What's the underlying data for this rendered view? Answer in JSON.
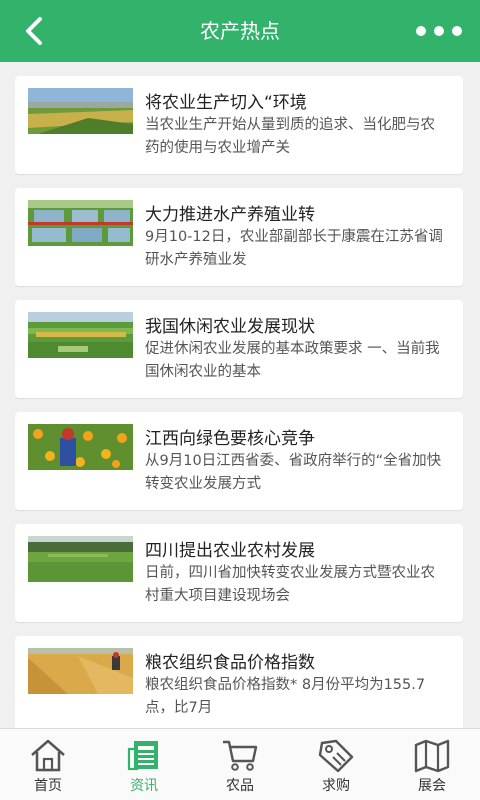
{
  "header": {
    "title": "农产热点"
  },
  "colors": {
    "accent": "#33b26b",
    "background": "#f0f0f0"
  },
  "articles": [
    {
      "title": "将农业生产切入“环境",
      "desc": "当农业生产开始从量到质的追求、当化肥与农药的使用与农业增产关"
    },
    {
      "title": "大力推进水产养殖业转",
      "desc": "9月10-12日，农业部副部长于康震在江苏省调研水产养殖业发"
    },
    {
      "title": "我国休闲农业发展现状",
      "desc": "促进休闲农业发展的基本政策要求 一、当前我国休闲农业的基本"
    },
    {
      "title": "江西向绿色要核心竞争",
      "desc": "从9月10日江西省委、省政府举行的“全省加快转变农业发展方式"
    },
    {
      "title": "四川提出农业农村发展",
      "desc": "日前，四川省加快转变农业发展方式暨农业农村重大项目建设现场会"
    },
    {
      "title": "粮农组织食品价格指数",
      "desc": "粮农组织食品价格指数* 8月份平均为155.7点，比7月"
    }
  ],
  "tabbar": {
    "items": [
      {
        "label": "首页",
        "icon": "home-icon"
      },
      {
        "label": "资讯",
        "icon": "news-icon"
      },
      {
        "label": "农品",
        "icon": "cart-icon"
      },
      {
        "label": "求购",
        "icon": "tag-icon"
      },
      {
        "label": "展会",
        "icon": "map-icon"
      }
    ],
    "active_index": 1
  }
}
